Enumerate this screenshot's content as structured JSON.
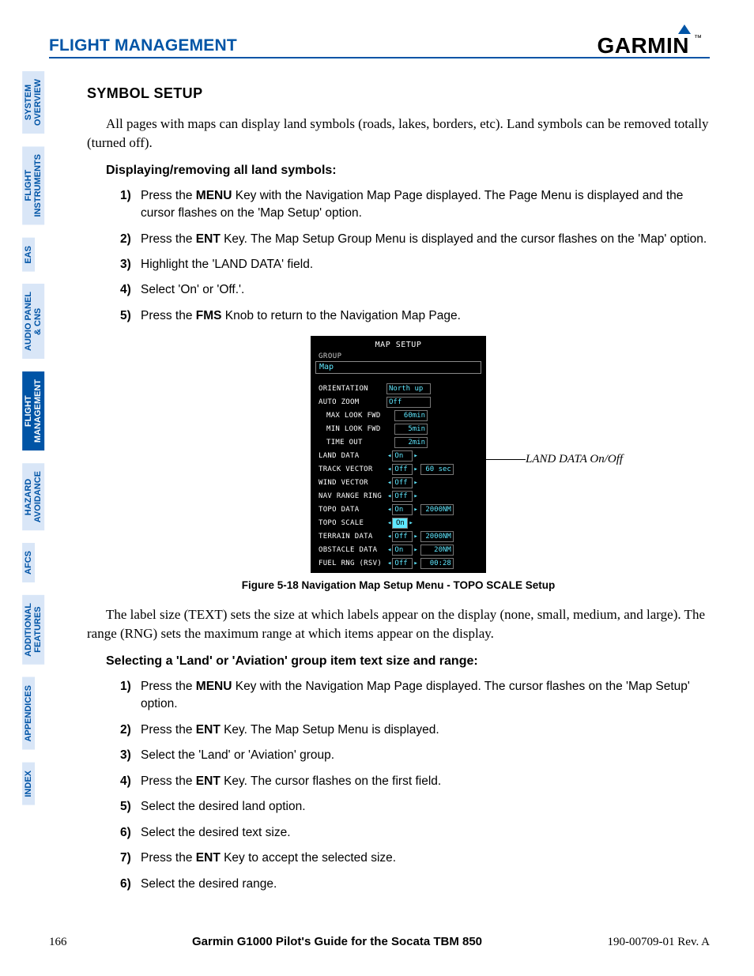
{
  "header": {
    "section": "FLIGHT MANAGEMENT",
    "brand": "GARMIN"
  },
  "tabs": [
    {
      "label": "SYSTEM\nOVERVIEW",
      "active": false
    },
    {
      "label": "FLIGHT\nINSTRUMENTS",
      "active": false
    },
    {
      "label": "EAS",
      "active": false
    },
    {
      "label": "AUDIO PANEL\n& CNS",
      "active": false
    },
    {
      "label": "FLIGHT\nMANAGEMENT",
      "active": true
    },
    {
      "label": "HAZARD\nAVOIDANCE",
      "active": false
    },
    {
      "label": "AFCS",
      "active": false
    },
    {
      "label": "ADDITIONAL\nFEATURES",
      "active": false
    },
    {
      "label": "APPENDICES",
      "active": false
    },
    {
      "label": "INDEX",
      "active": false
    }
  ],
  "heading": "SYMBOL SETUP",
  "intro": "All pages with maps can display land symbols (roads, lakes, borders, etc).  Land symbols can be removed totally (turned off).",
  "proc1": {
    "title": "Displaying/removing all land symbols:",
    "steps": [
      {
        "n": "1)",
        "pre": "Press the ",
        "bold": "MENU",
        "post": " Key with the Navigation Map Page displayed.  The Page Menu is displayed and the cursor flashes on the 'Map Setup' option."
      },
      {
        "n": "2)",
        "pre": "Press the ",
        "bold": "ENT",
        "post": " Key.  The Map Setup Group Menu is displayed and the cursor flashes on the 'Map' option."
      },
      {
        "n": "3)",
        "pre": "",
        "bold": "",
        "post": "Highlight the 'LAND DATA' field."
      },
      {
        "n": "4)",
        "pre": "",
        "bold": "",
        "post": "Select 'On' or 'Off.'."
      },
      {
        "n": "5)",
        "pre": "Press the ",
        "bold": "FMS",
        "post": " Knob to return to the Navigation Map Page."
      }
    ]
  },
  "figure": {
    "panel_title": "MAP SETUP",
    "group_label": "GROUP",
    "group_value": "Map",
    "rows": [
      {
        "label": "ORIENTATION",
        "val": "North up",
        "style": "left"
      },
      {
        "label": "AUTO ZOOM",
        "val": "Off",
        "style": "left"
      },
      {
        "label": "MAX LOOK FWD",
        "val": "60min",
        "indent": true
      },
      {
        "label": "MIN LOOK FWD",
        "val": "5min",
        "indent": true
      },
      {
        "label": "TIME OUT",
        "val": "2min",
        "indent": true
      },
      {
        "label": "LAND DATA",
        "val": "On",
        "arrows": true
      },
      {
        "label": "TRACK VECTOR",
        "val": "Off",
        "arrows": true,
        "ext": "60 sec"
      },
      {
        "label": "WIND VECTOR",
        "val": "Off",
        "arrows": true
      },
      {
        "label": "NAV RANGE RING",
        "val": "Off",
        "arrows": true
      },
      {
        "label": "TOPO DATA",
        "val": "On",
        "arrows": true,
        "ext": "2000NM"
      },
      {
        "label": "TOPO SCALE",
        "val": "On",
        "arrows": true,
        "selected": true
      },
      {
        "label": "TERRAIN DATA",
        "val": "Off",
        "arrows": true,
        "ext": "2000NM"
      },
      {
        "label": "OBSTACLE DATA",
        "val": "On",
        "arrows": true,
        "ext": "20NM"
      },
      {
        "label": "FUEL RNG (RSV)",
        "val": "Off",
        "arrows": true,
        "ext": "00:28"
      }
    ],
    "callout": "LAND DATA On/Off",
    "caption": "Figure 5-18  Navigation Map Setup Menu - TOPO SCALE Setup"
  },
  "para2": "The label size (TEXT) sets the size at which labels appear on the display (none, small, medium, and large).  The range (RNG) sets the maximum range at which items appear on the display.",
  "proc2": {
    "title": "Selecting a 'Land' or 'Aviation' group item text size and range:",
    "steps": [
      {
        "n": "1)",
        "pre": "Press the ",
        "bold": "MENU",
        "post": " Key with the Navigation Map Page displayed.  The cursor flashes on the 'Map Setup' option."
      },
      {
        "n": "2)",
        "pre": "Press the ",
        "bold": "ENT",
        "post": " Key.  The Map Setup Menu is displayed."
      },
      {
        "n": "3)",
        "pre": "",
        "bold": "",
        "post": "Select the 'Land'  or 'Aviation' group."
      },
      {
        "n": "4)",
        "pre": "Press the ",
        "bold": "ENT",
        "post": " Key.  The cursor flashes on the first field."
      },
      {
        "n": "5)",
        "pre": "",
        "bold": "",
        "post": "Select the desired land option."
      },
      {
        "n": "6)",
        "pre": "",
        "bold": "",
        "post": "Select the desired text size."
      },
      {
        "n": "7)",
        "pre": "Press the ",
        "bold": "ENT",
        "post": " Key to accept the selected size."
      },
      {
        "n": "6)",
        "pre": "",
        "bold": "",
        "post": "Select the desired range."
      }
    ]
  },
  "footer": {
    "page": "166",
    "title": "Garmin G1000 Pilot's Guide for the Socata TBM 850",
    "rev": "190-00709-01  Rev. A"
  }
}
